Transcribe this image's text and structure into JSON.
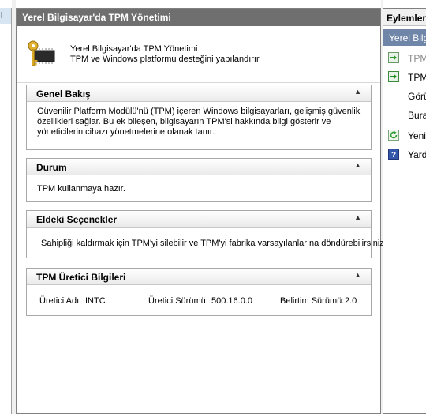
{
  "left_pane": {
    "selected_fragment": "i"
  },
  "main": {
    "title": "Yerel Bilgisayar'da TPM Yönetimi",
    "header_line1": "Yerel Bilgisayar'da TPM Yönetimi",
    "header_line2": "TPM ve Windows platformu desteğini yapılandırır"
  },
  "panels": {
    "overview": {
      "title": "Genel Bakış",
      "text": "Güvenilir Platform Modülü'nü (TPM) içeren Windows bilgisayarları, gelişmiş güvenlik özellikleri sağlar. Bu ek bileşen, bilgisayarın TPM'si hakkında bilgi gösterir ve yöneticilerin cihazı yönetmelerine olanak tanır."
    },
    "status": {
      "title": "Durum",
      "text": "TPM kullanmaya hazır."
    },
    "options": {
      "title": "Eldeki Seçenekler",
      "text": "Sahipliği kaldırmak için TPM'yi silebilir ve TPM'yi fabrika varsayılanlarına döndürebilirsiniz."
    },
    "manufacturer": {
      "title": "TPM Üretici Bilgileri",
      "maker_label": "Üretici Adı:",
      "maker_value": "INTC",
      "version_label": "Üretici Sürümü:",
      "version_value": "500.16.0.0",
      "spec_label": "Belirtim Sürümü:",
      "spec_value": "2.0"
    },
    "collapse_glyph": "▲"
  },
  "actions": {
    "title": "Eylemler",
    "section": "Yerel Bilg",
    "items": [
      {
        "label": "TPM",
        "icon": "green-arrow-icon",
        "disabled": true
      },
      {
        "label": "TPM",
        "icon": "green-arrow-icon",
        "disabled": false
      },
      {
        "label": "Görü",
        "icon": "",
        "disabled": false
      },
      {
        "label": "Bura",
        "icon": "",
        "disabled": false
      },
      {
        "label": "Yeni",
        "icon": "refresh-icon",
        "disabled": false
      },
      {
        "label": "Yard",
        "icon": "help-icon",
        "disabled": false
      }
    ]
  },
  "colors": {
    "title_bar": "#6f6f6f",
    "action_section": "#6f86a8",
    "help_icon": "#3355aa",
    "arrow_icon": "#2f9a2f"
  }
}
